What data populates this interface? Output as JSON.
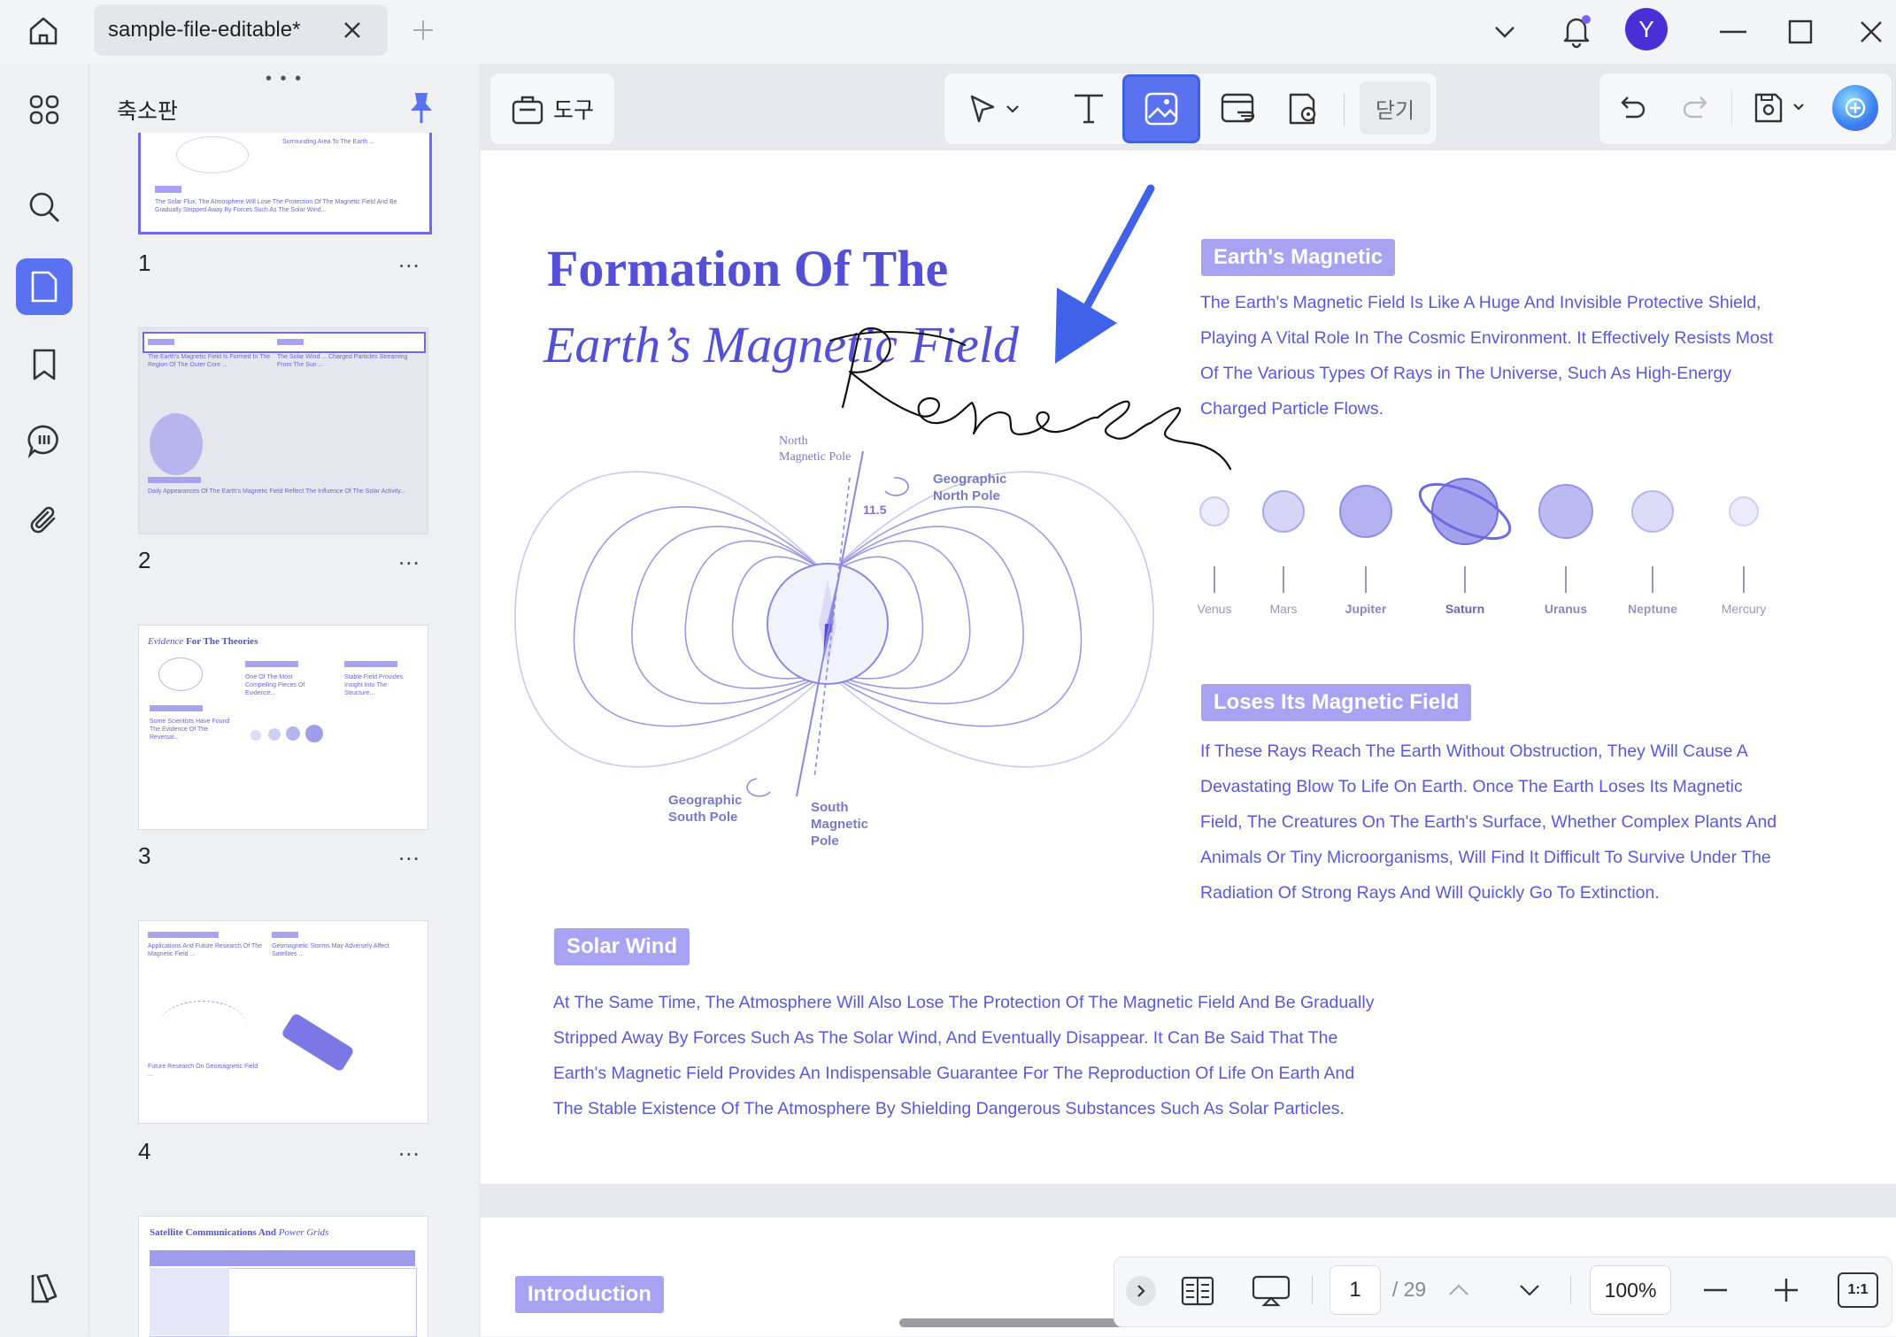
{
  "tab": {
    "title": "sample-file-editable*"
  },
  "user": {
    "initial": "Y"
  },
  "panel": {
    "title": "축소판"
  },
  "toolbar": {
    "tools_label": "도구",
    "close_label": "닫기"
  },
  "thumbnails": [
    {
      "page": "1",
      "more": "..."
    },
    {
      "page": "2",
      "more": "..."
    },
    {
      "page": "3",
      "more": "...",
      "title_em": "Evidence",
      "title": "For The Theories"
    },
    {
      "page": "4",
      "more": "..."
    },
    {
      "page": "5",
      "title": "Satellite Communications And",
      "title_em": "Power Grids"
    }
  ],
  "document": {
    "title_line1": "Formation Of The",
    "title_line2": "Earth’s Magnetic Field",
    "handwriting": "Renee",
    "diagram": {
      "north_magnetic": [
        "North",
        "Magnetic Pole"
      ],
      "geo_north": [
        "Geographic",
        "North Pole"
      ],
      "angle": "11.5",
      "geo_south": [
        "Geographic",
        "South Pole"
      ],
      "south_magnetic": [
        "South",
        "Magnetic",
        "Pole"
      ]
    },
    "section1": {
      "heading": "Earth's Magnetic",
      "lines": [
        "The Earth's Magnetic Field Is Like A Huge And Invisible Protective Shield,",
        "Playing A Vital Role In The Cosmic Environment. It Effectively Resists Most",
        "Of The Various Types Of Rays in The Universe, Such As High-Energy",
        "Charged Particle Flows."
      ]
    },
    "planets": [
      "Venus",
      "Mars",
      "Jupiter",
      "Saturn",
      "Uranus",
      "Neptune",
      "Mercury"
    ],
    "section2": {
      "heading": "Loses Its Magnetic Field",
      "lines": [
        "If These Rays Reach The Earth Without Obstruction, They Will Cause A",
        "Devastating Blow To Life On Earth. Once The Earth Loses Its Magnetic",
        "Field, The Creatures On The Earth's Surface, Whether Complex Plants And",
        "Animals Or Tiny Microorganisms, Will Find It Difficult To Survive Under The",
        "Radiation Of Strong Rays And Will Quickly Go To Extinction."
      ]
    },
    "section3": {
      "heading": "Solar Wind",
      "lines": [
        "At The Same Time, The Atmosphere Will Also Lose The Protection Of The Magnetic Field And Be Gradually",
        "Stripped Away By Forces Such As The Solar Wind, And Eventually Disappear. It Can Be Said That The",
        "Earth's Magnetic Field Provides An Indispensable Guarantee For The Reproduction Of Life On Earth And",
        "The Stable Existence Of The Atmosphere By Shielding Dangerous Substances Such As Solar Particles."
      ]
    },
    "next_page_heading": "Introduction"
  },
  "pager": {
    "current": "1",
    "total": "/ 29",
    "zoom": "100%",
    "fit": "1:1"
  },
  "colors": {
    "accent": "#5b72f0",
    "doc_purple": "#5350d6",
    "pill": "#a8a2f2",
    "arrow": "#3f62e8"
  }
}
